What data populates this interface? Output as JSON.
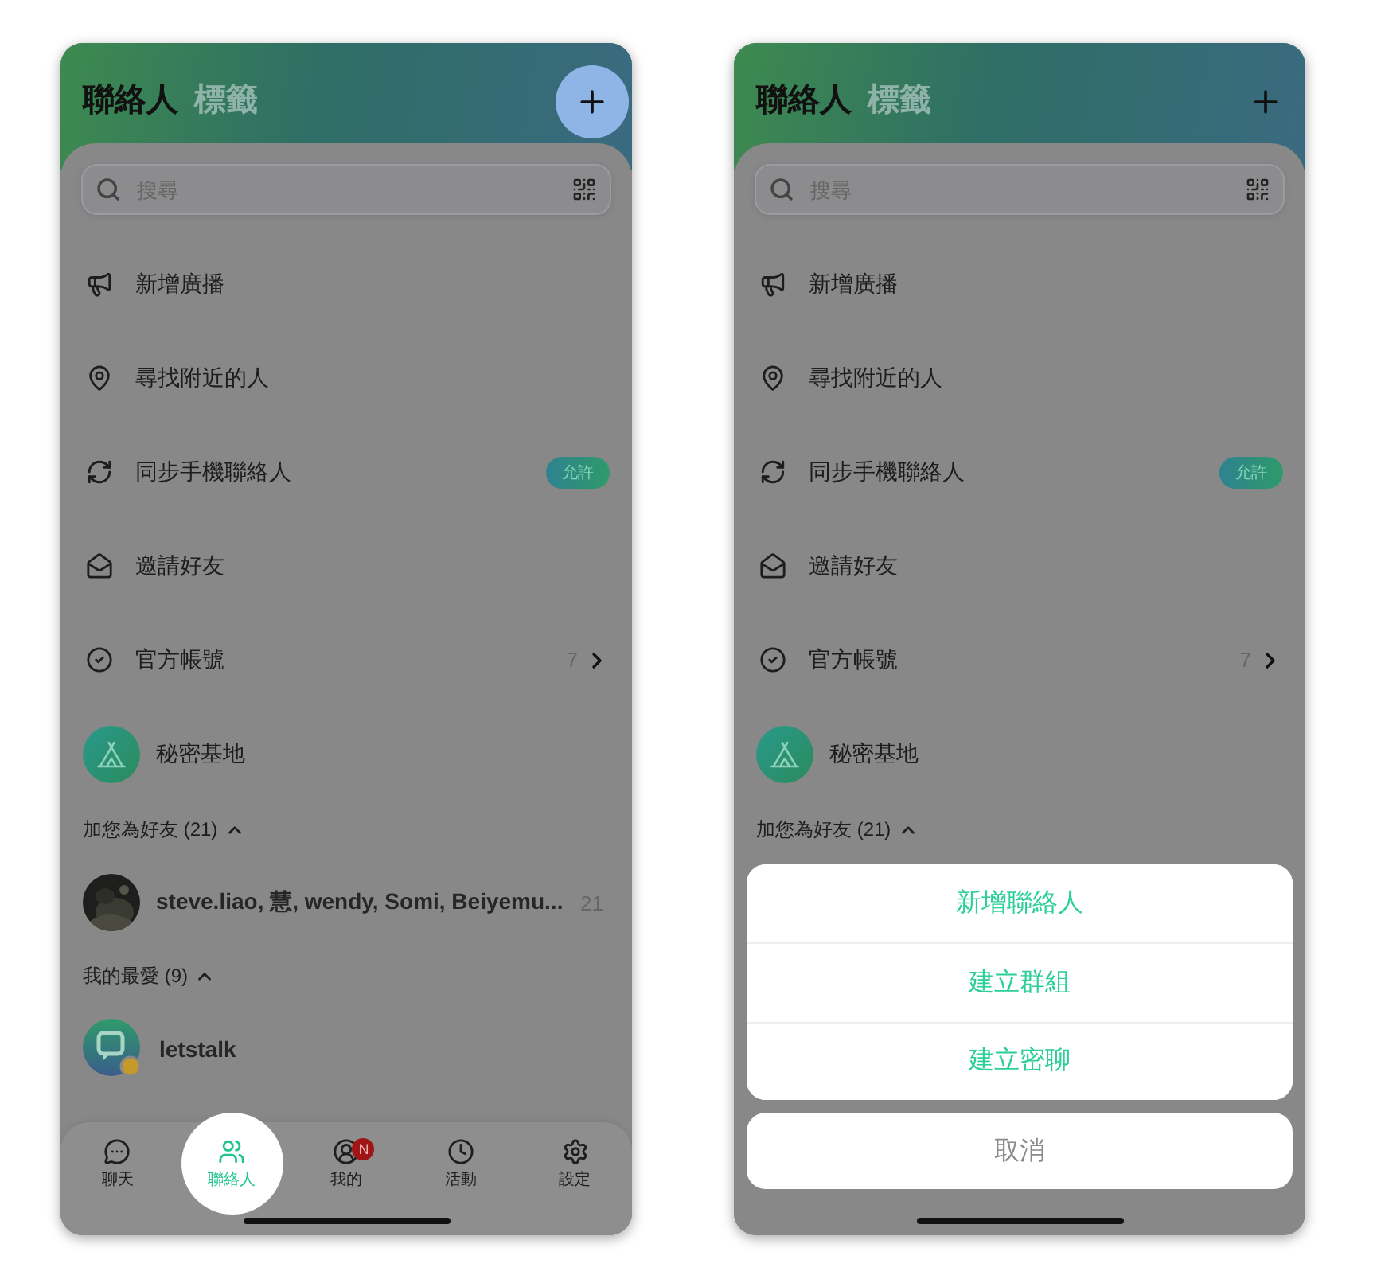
{
  "screens": [
    {
      "tabs": [
        {
          "label": "聯絡人",
          "selected": true
        },
        {
          "label": "標籤",
          "selected": false
        }
      ],
      "add_button": {
        "highlighted": true
      },
      "search": {
        "placeholder": "搜尋"
      },
      "menu": [
        {
          "label": "新增廣播"
        },
        {
          "label": "尋找附近的人"
        },
        {
          "label": "同步手機聯絡人",
          "badge": "允許"
        },
        {
          "label": "邀請好友"
        },
        {
          "label": "官方帳號",
          "count": "7",
          "chevron": true
        }
      ],
      "base": {
        "label": "秘密基地"
      },
      "sections": [
        {
          "title": "加您為好友 (21)",
          "expanded": true,
          "contacts": [
            {
              "name": "steve.liao, 慧, wendy, Somi, Beiyemu...",
              "count": "21"
            }
          ]
        },
        {
          "title": "我的最愛 (9)",
          "expanded": true,
          "contacts": [
            {
              "kind": "logo",
              "name": "letstalk"
            }
          ]
        }
      ],
      "tab_bar": [
        {
          "label": "聊天",
          "selected": false
        },
        {
          "label": "聯絡人",
          "selected": true
        },
        {
          "label": "我的",
          "selected": false,
          "badge": "N"
        },
        {
          "label": "活動",
          "selected": false
        },
        {
          "label": "設定",
          "selected": false
        }
      ]
    },
    {
      "tabs": [
        {
          "label": "聯絡人",
          "selected": true
        },
        {
          "label": "標籤",
          "selected": false
        }
      ],
      "add_button": {
        "highlighted": false
      },
      "search": {
        "placeholder": "搜尋"
      },
      "menu": [
        {
          "label": "新增廣播"
        },
        {
          "label": "尋找附近的人"
        },
        {
          "label": "同步手機聯絡人",
          "badge": "允許"
        },
        {
          "label": "邀請好友"
        },
        {
          "label": "官方帳號",
          "count": "7",
          "chevron": true
        }
      ],
      "base": {
        "label": "秘密基地"
      },
      "sections": [
        {
          "title": "加您為好友 (21)",
          "expanded": true
        }
      ],
      "action_sheet": {
        "actions": [
          "新增聯絡人",
          "建立群組",
          "建立密聊"
        ],
        "cancel": "取消"
      }
    }
  ]
}
